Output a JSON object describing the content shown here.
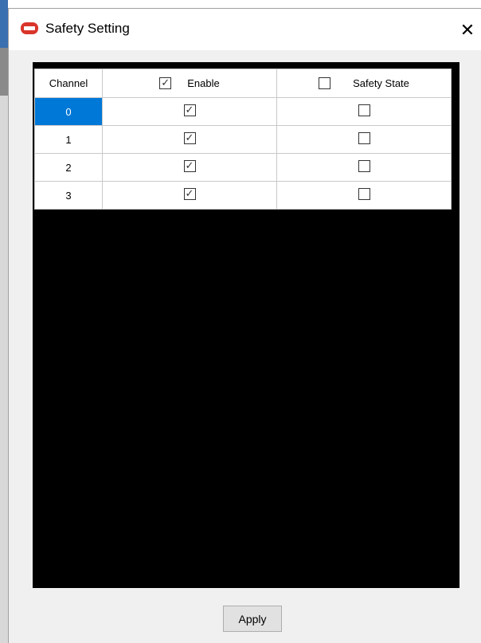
{
  "window": {
    "title": "Safety Setting",
    "close_glyph": "✕",
    "icon": "stop-sign-icon"
  },
  "grid": {
    "headers": {
      "channel": "Channel",
      "enable": "Enable",
      "enable_all_checked": true,
      "safety_state": "Safety State",
      "safety_state_all_checked": false
    },
    "rows": [
      {
        "channel": "0",
        "enable": true,
        "safety_state": false,
        "selected": true
      },
      {
        "channel": "1",
        "enable": true,
        "safety_state": false,
        "selected": false
      },
      {
        "channel": "2",
        "enable": true,
        "safety_state": false,
        "selected": false
      },
      {
        "channel": "3",
        "enable": true,
        "safety_state": false,
        "selected": false
      }
    ]
  },
  "footer": {
    "apply_label": "Apply"
  },
  "colors": {
    "selection": "#0078d7",
    "grid_background": "#000000",
    "window_background": "#f0f0f0"
  }
}
